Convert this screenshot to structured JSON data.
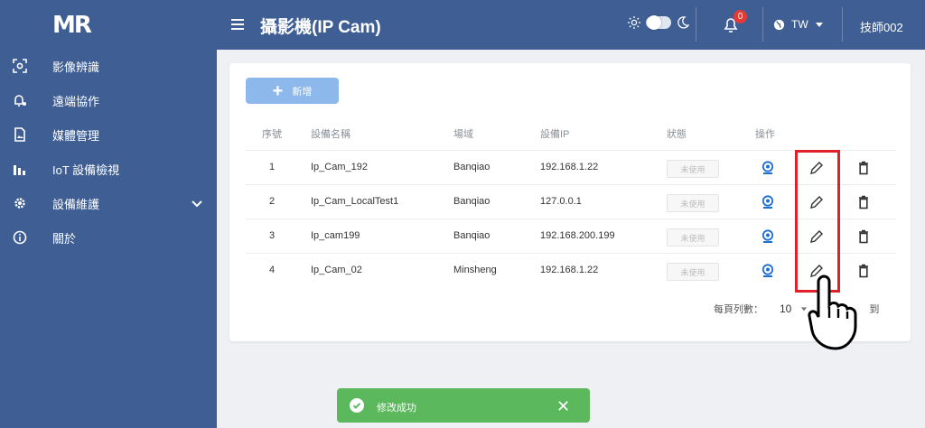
{
  "app": {
    "logo": "MR"
  },
  "sidebar": {
    "items": [
      {
        "label": "影像辨識",
        "icon": "camera-scan-icon"
      },
      {
        "label": "遠端協作",
        "icon": "bell-gear-icon"
      },
      {
        "label": "媒體管理",
        "icon": "image-file-icon"
      },
      {
        "label": "IoT 設備檢視",
        "icon": "bar-chart-icon"
      },
      {
        "label": "設備維護",
        "icon": "gear-icon",
        "expandable": true
      },
      {
        "label": "關於",
        "icon": "info-icon"
      }
    ]
  },
  "header": {
    "title": "攝影機(IP Cam)",
    "notifications": "0",
    "language": "TW",
    "user": "技師002"
  },
  "toolbar": {
    "add_label": "新增"
  },
  "table": {
    "columns": [
      "序號",
      "設備名稱",
      "場域",
      "設備IP",
      "狀態",
      "操作"
    ],
    "rows": [
      {
        "no": "1",
        "name": "Ip_Cam_192",
        "site": "Banqiao",
        "ip": "192.168.1.22",
        "status": "未使用"
      },
      {
        "no": "2",
        "name": "Ip_Cam_LocalTest1",
        "site": "Banqiao",
        "ip": "127.0.0.1",
        "status": "未使用"
      },
      {
        "no": "3",
        "name": "Ip_cam199",
        "site": "Banqiao",
        "ip": "192.168.200.199",
        "status": "未使用"
      },
      {
        "no": "4",
        "name": "Ip_Cam_02",
        "site": "Minsheng",
        "ip": "192.168.1.22",
        "status": "未使用"
      }
    ]
  },
  "pagination": {
    "rows_per_page_label": "每頁列數：",
    "rows_per_page": "10",
    "tail_text": "到"
  },
  "toast": {
    "message": "修改成功"
  },
  "colors": {
    "sidebar": "#3f5f94",
    "accent": "#8cb8ec",
    "success": "#5cb85c",
    "highlight": "#e0202b",
    "link": "#1e6fd0"
  }
}
